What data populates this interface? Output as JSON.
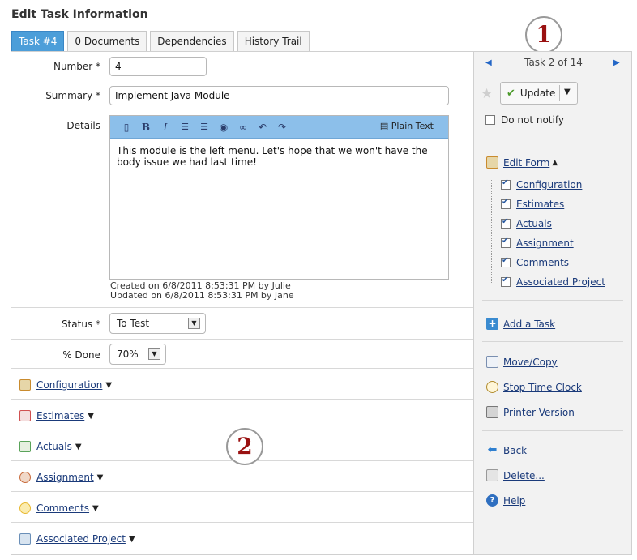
{
  "page": {
    "title": "Edit Task Information"
  },
  "tabs": [
    {
      "label": "Task #4"
    },
    {
      "label": "0 Documents"
    },
    {
      "label": "Dependencies"
    },
    {
      "label": "History Trail"
    }
  ],
  "form": {
    "number": {
      "label": "Number *",
      "value": "4"
    },
    "summary": {
      "label": "Summary *",
      "value": "Implement Java Module"
    },
    "details": {
      "label": "Details",
      "plain_text_label": "Plain Text",
      "text": "This module is the left menu. Let's hope that we won't have the body issue we had last time!",
      "created": "Created on 6/8/2011 8:53:31 PM by Julie",
      "updated": "Updated on 6/8/2011 8:53:31 PM by Jane"
    },
    "status": {
      "label": "Status *",
      "value": "To Test"
    },
    "percent_done": {
      "label": "% Done",
      "value": "70%"
    }
  },
  "sections": [
    {
      "label": "Configuration",
      "icon": "pencil-form-icon",
      "color": "#c98b2e"
    },
    {
      "label": "Estimates",
      "icon": "calendar-icon",
      "color": "#d05050"
    },
    {
      "label": "Actuals",
      "icon": "calendar-check-icon",
      "color": "#5aa35a"
    },
    {
      "label": "Assignment",
      "icon": "people-icon",
      "color": "#c86a3a"
    },
    {
      "label": "Comments",
      "icon": "speech-bubble-icon",
      "color": "#e8b830"
    },
    {
      "label": "Associated Project",
      "icon": "project-icon",
      "color": "#6a8fb8"
    }
  ],
  "callouts": {
    "one": "1",
    "two": "2"
  },
  "side": {
    "counter": "Task 2 of 14",
    "update_label": "Update",
    "do_not_notify": "Do not notify",
    "edit_form": "Edit Form",
    "edit_form_items": [
      {
        "label": "Configuration",
        "checked": true
      },
      {
        "label": "Estimates",
        "checked": true
      },
      {
        "label": "Actuals",
        "checked": true
      },
      {
        "label": "Assignment",
        "checked": true
      },
      {
        "label": "Comments",
        "checked": true
      },
      {
        "label": "Associated Project",
        "checked": true
      }
    ],
    "add_task": "Add a Task",
    "move_copy": "Move/Copy",
    "stop_clock": "Stop Time Clock",
    "printer": "Printer Version",
    "back": "Back",
    "delete": "Delete...",
    "help": "Help"
  },
  "colors": {
    "accent": "#4c9ed9",
    "toolbar": "#8cbfea",
    "callout_text": "#9a1111",
    "link": "#1a3a7a"
  }
}
